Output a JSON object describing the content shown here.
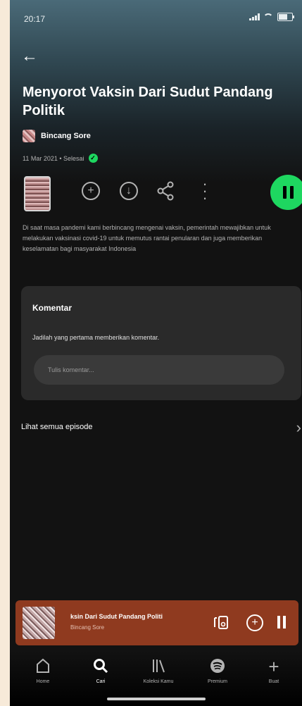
{
  "status": {
    "time": "20:17"
  },
  "episode": {
    "title": "Menyorot Vaksin Dari Sudut Pandang Politik",
    "show_name": "Bincang Sore",
    "meta": "11 Mar 2021 • Selesai",
    "description": "Di saat masa pandemi kami berbincang mengenai vaksin, pemerintah mewajibkan untuk melakukan vaksinasi covid-19 untuk memutus rantai penularan dan juga memberikan keselamatan bagi masyarakat Indonesia"
  },
  "comments": {
    "title": "Komentar",
    "subtitle": "Jadilah yang pertama memberikan komentar.",
    "input_placeholder": "Tulis komentar..."
  },
  "see_all": {
    "label": "Lihat semua episode"
  },
  "mini_player": {
    "title": "ksin Dari Sudut Pandang Politi",
    "subtitle": "Bincang Sore"
  },
  "nav": [
    {
      "label": "Home",
      "icon": "home-icon"
    },
    {
      "label": "Cari",
      "icon": "search-icon"
    },
    {
      "label": "Koleksi Kamu",
      "icon": "library-icon"
    },
    {
      "label": "Premium",
      "icon": "spotify-icon"
    },
    {
      "label": "Buat",
      "icon": "plus-icon"
    }
  ],
  "colors": {
    "accent": "#1ed760",
    "mini_player_bg": "#8f3a1f",
    "background": "#121212"
  }
}
